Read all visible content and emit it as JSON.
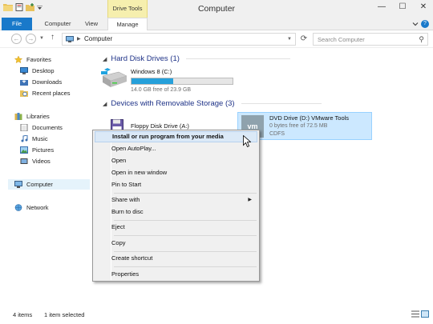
{
  "window": {
    "title": "Computer",
    "contextual_tab_group": "Drive Tools",
    "minimize_glyph": "—",
    "maximize_glyph": "☐",
    "close_glyph": "✕"
  },
  "ribbon": {
    "tabs": [
      {
        "label": "File"
      },
      {
        "label": "Computer"
      },
      {
        "label": "View"
      },
      {
        "label": "Manage"
      }
    ],
    "help_glyph": "?"
  },
  "navigation": {
    "back_glyph": "←",
    "forward_glyph": "→",
    "up_glyph": "↑",
    "refresh_glyph": "⟳",
    "address_path": "Computer",
    "search_placeholder": "Search Computer"
  },
  "sidebar": {
    "favorites": {
      "label": "Favorites",
      "items": [
        "Desktop",
        "Downloads",
        "Recent places"
      ]
    },
    "libraries": {
      "label": "Libraries",
      "items": [
        "Documents",
        "Music",
        "Pictures",
        "Videos"
      ]
    },
    "computer": "Computer",
    "network": "Network"
  },
  "content": {
    "hard_disk_group": "Hard Disk Drives (1)",
    "removable_group": "Devices with Removable Storage (3)",
    "drives": {
      "c": {
        "name": "Windows 8 (C:)",
        "free_text": "14.0 GB free of 23.9 GB",
        "used_fraction": 0.41
      },
      "floppy": {
        "name": "Floppy Disk Drive (A:)"
      },
      "dvd": {
        "name": "DVD Drive (D:) VMware Tools",
        "free_text": "0 bytes free of 72.5 MB",
        "filesystem": "CDFS",
        "logo_text": "vm"
      }
    }
  },
  "context_menu": {
    "items": {
      "install": "Install or run program from your media",
      "autoplay": "Open AutoPlay...",
      "open": "Open",
      "open_new_window": "Open in new window",
      "pin": "Pin to Start",
      "share": "Share with",
      "burn": "Burn to disc",
      "eject": "Eject",
      "copy": "Copy",
      "shortcut": "Create shortcut",
      "properties": "Properties"
    }
  },
  "status": {
    "item_count": "4 items",
    "selection": "1 item selected"
  },
  "colors": {
    "accent": "#1979ca",
    "selection": "#cce8ff",
    "drive_bar": "#26a0da",
    "group_header": "#1e3287",
    "contextual_tab": "#f6efae"
  }
}
